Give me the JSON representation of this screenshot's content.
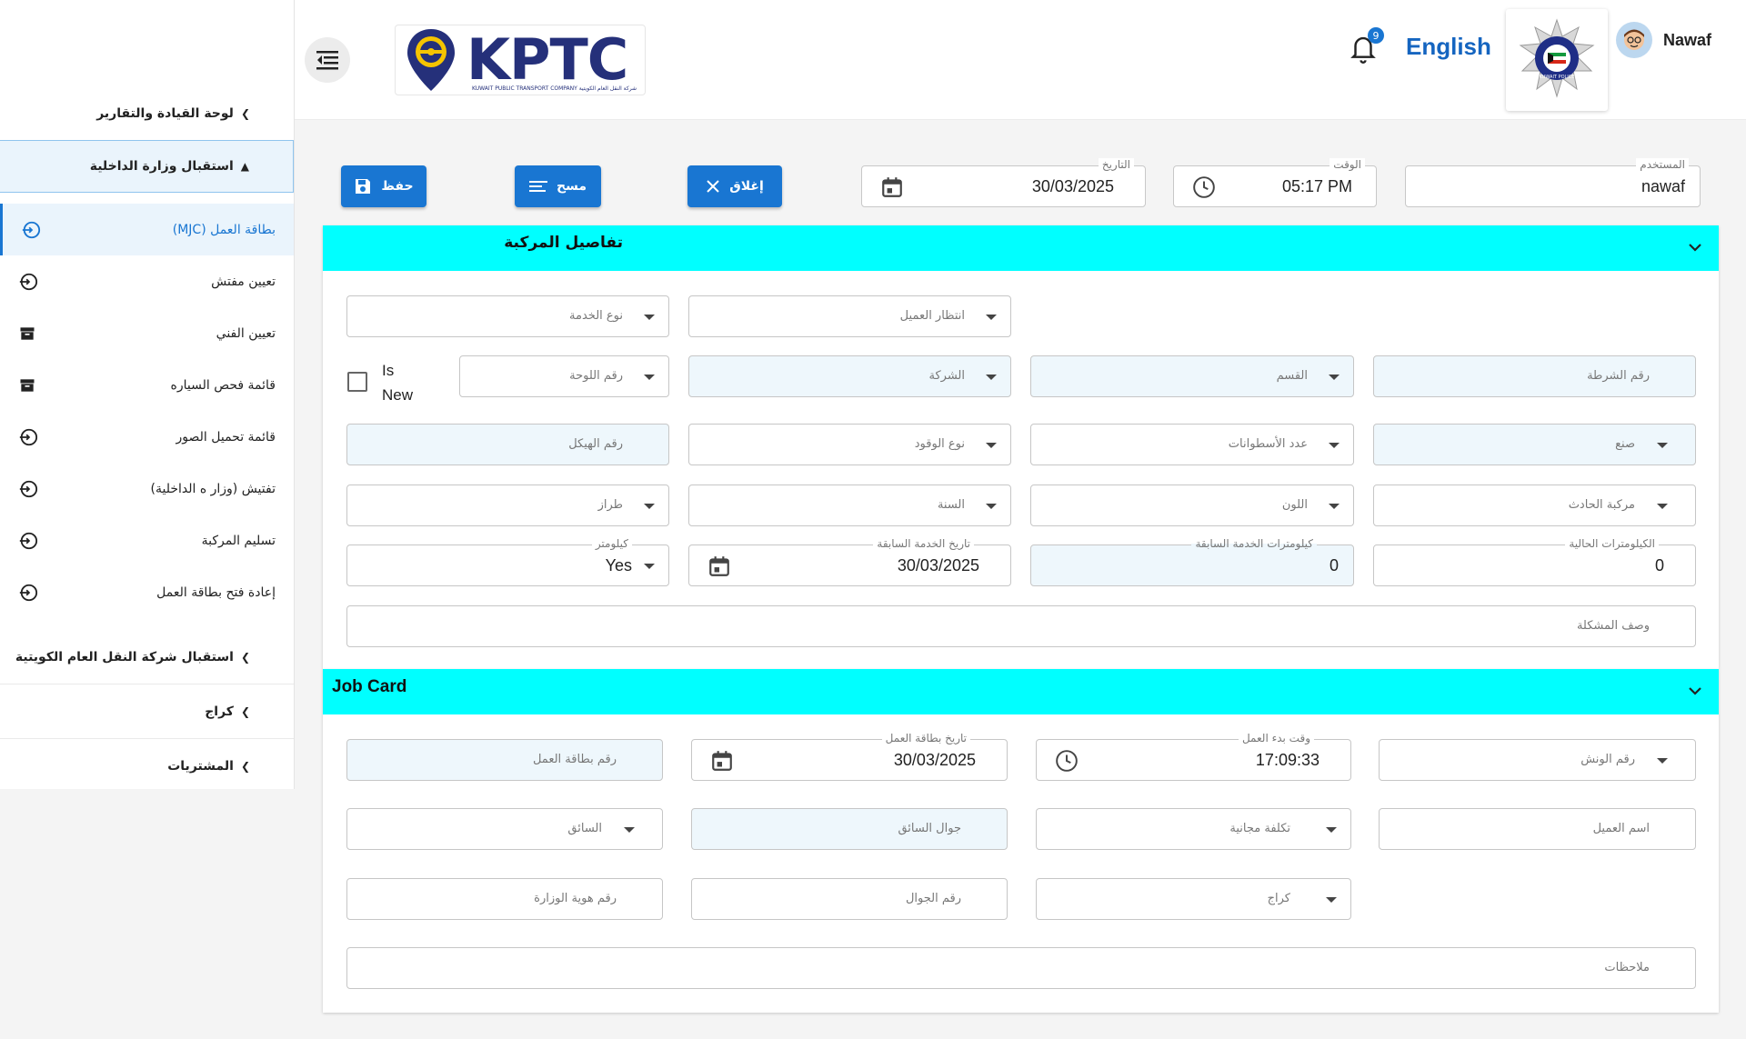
{
  "header": {
    "logo_text": "KPTC",
    "logo_subtitle": "KUWAIT PUBLIC TRANSPORT COMPANY   شركة النقل العام الكويتية",
    "notification_count": "9",
    "language_toggle": "English",
    "police_logo_text": "KUWAIT POLICE",
    "user_name": "Nawaf"
  },
  "sidebar": {
    "group_dashboard": "لوحة القيادة والتقارير",
    "group_moi": "استقبال وزارة الداخلية",
    "items": [
      {
        "label": "بطاقة العمل (MJC)",
        "icon": "login-icon"
      },
      {
        "label": "تعيين مفتش",
        "icon": "login-icon"
      },
      {
        "label": "تعيين الفني",
        "icon": "archive-icon"
      },
      {
        "label": "قائمة فحص السياره",
        "icon": "archive-icon"
      },
      {
        "label": "قائمة تحميل الصور",
        "icon": "login-icon"
      },
      {
        "label": "تفتيش (وزار ه الداخلية)",
        "icon": "login-icon"
      },
      {
        "label": "تسليم المركبة",
        "icon": "login-icon"
      },
      {
        "label": "إعادة فتح بطاقة العمل",
        "icon": "login-icon"
      }
    ],
    "group_kptc": "استقبال شركة النقل العام الكويتية",
    "group_garage": "كراج",
    "group_purchases": "المشتريات"
  },
  "top_bar": {
    "user_label": "المستخدم",
    "user_value": "nawaf",
    "time_label": "الوقت",
    "time_value": "05:17 PM",
    "date_label": "التاريخ",
    "date_value": "30/03/2025",
    "close_button": "إغلاق",
    "clear_button": "مسح",
    "save_button": "حفظ"
  },
  "vehicle_details": {
    "title": "تفاصيل المركبة",
    "service_type": "نوع الخدمة",
    "customer_wait": "انتظار العميل",
    "is_new_label": "Is New",
    "is_new_checked": false,
    "plate_number": "رقم اللوحة",
    "company": "الشركة",
    "department": "القسم",
    "police_number": "رقم الشرطة",
    "chassis_number": "رقم الهيكل",
    "fuel_type": "نوع الوقود",
    "cylinders": "عدد الأسطوانات",
    "make": "صنع",
    "model": "طراز",
    "year": "السنة",
    "color": "اللون",
    "incident_vehicle": "مركبة الحادث",
    "km_label": "كيلومتر",
    "km_value": "Yes",
    "last_service_date_label": "تاريخ الخدمة السابقة",
    "last_service_date_value": "30/03/2025",
    "last_service_km_label": "كيلومترات الخدمة السابقة",
    "last_service_km_value": "0",
    "current_km_label": "الكيلومترات الحالية",
    "current_km_value": "0",
    "problem_description": "وصف المشكلة"
  },
  "job_card": {
    "title": "Job Card",
    "job_card_number": "رقم بطاقة العمل",
    "job_card_date_label": "تاريخ بطاقة العمل",
    "job_card_date_value": "30/03/2025",
    "work_start_time_label": "وقت بدء العمل",
    "work_start_time_value": "17:09:33",
    "winch_number": "رقم الونش",
    "driver": "السائق",
    "driver_mobile": "جوال السائق",
    "free_cost": "تكلفة مجانية",
    "customer_name": "اسم العميل",
    "moi_id_number": "رقم هوية الوزارة",
    "mobile_number": "رقم الجوال",
    "garage": "كراج",
    "notes": "ملاحظات"
  },
  "colors": {
    "primary": "#1976d2",
    "section_header": "#00ffff",
    "brand_navy": "#25307a"
  }
}
